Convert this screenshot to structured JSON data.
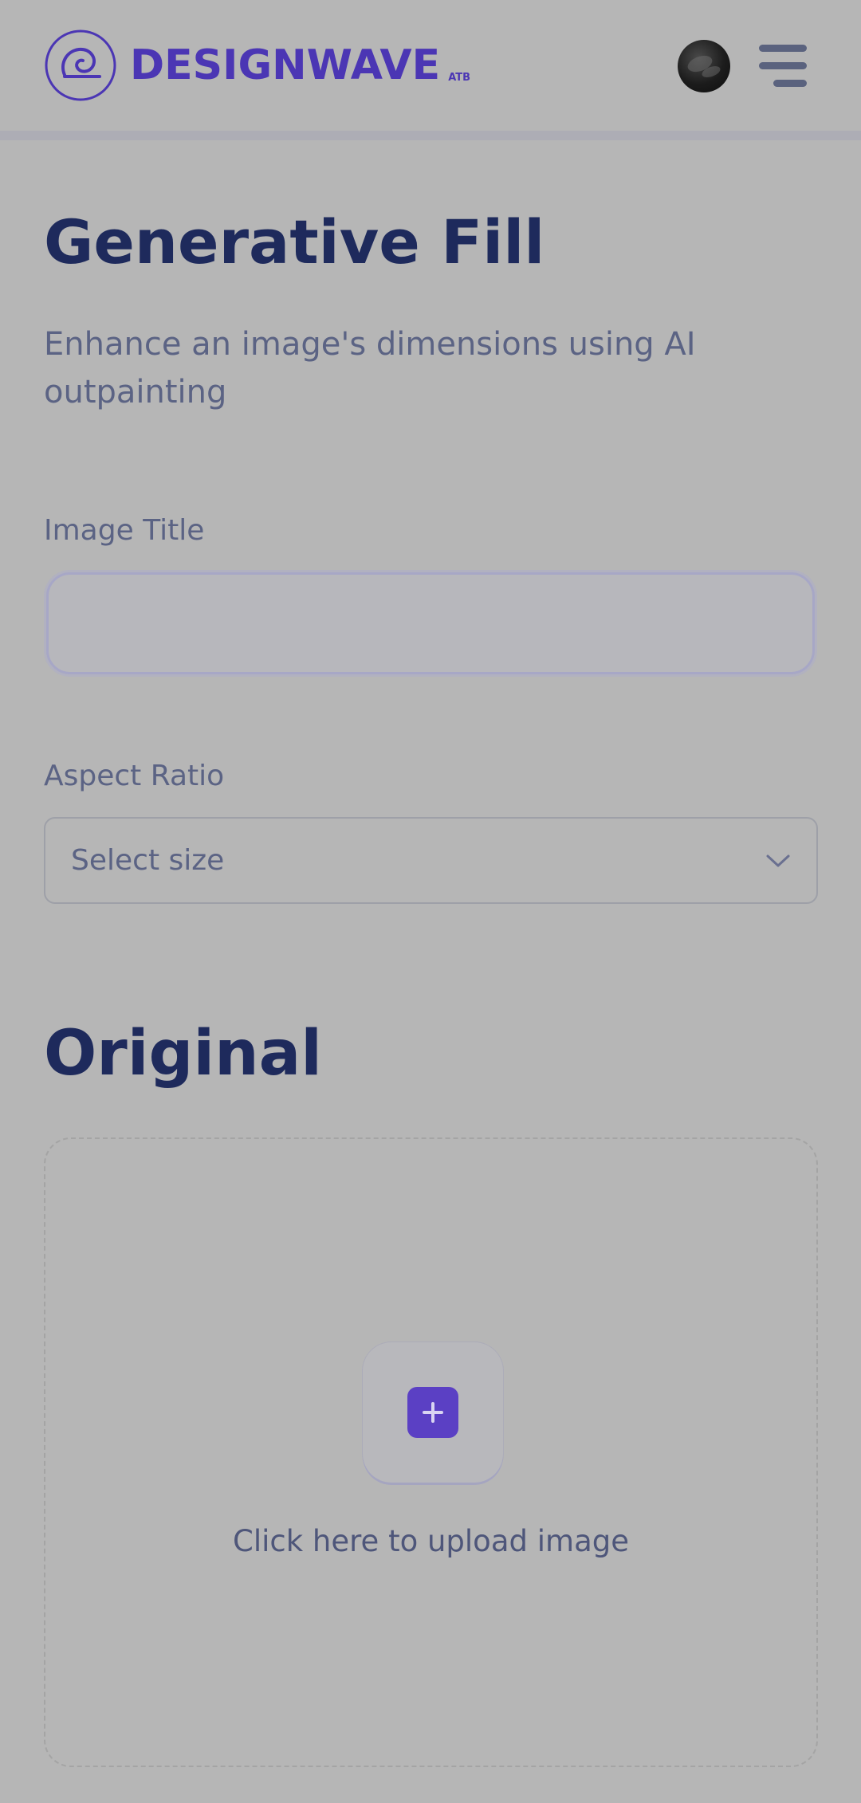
{
  "header": {
    "brand_name": "DESIGNWAVE",
    "brand_tag": "ATB",
    "logo_icon": "wave-spiral-icon",
    "menu_icon": "hamburger-menu-icon",
    "accent_color": "#4b36b4"
  },
  "main": {
    "title": "Generative Fill",
    "subtitle": "Enhance an image's dimensions using AI outpainting",
    "fields": {
      "image_title": {
        "label": "Image Title",
        "value": "",
        "placeholder": ""
      },
      "aspect_ratio": {
        "label": "Aspect Ratio",
        "value": "Select size",
        "icon": "chevron-down-icon"
      }
    },
    "original": {
      "heading": "Original",
      "upload_label": "Click here to upload image",
      "upload_icon": "plus-icon",
      "button_color": "#5b40c4"
    }
  },
  "colors": {
    "background": "#b6b6b6",
    "heading": "#1e2a5c",
    "muted_text": "#5b6384"
  }
}
